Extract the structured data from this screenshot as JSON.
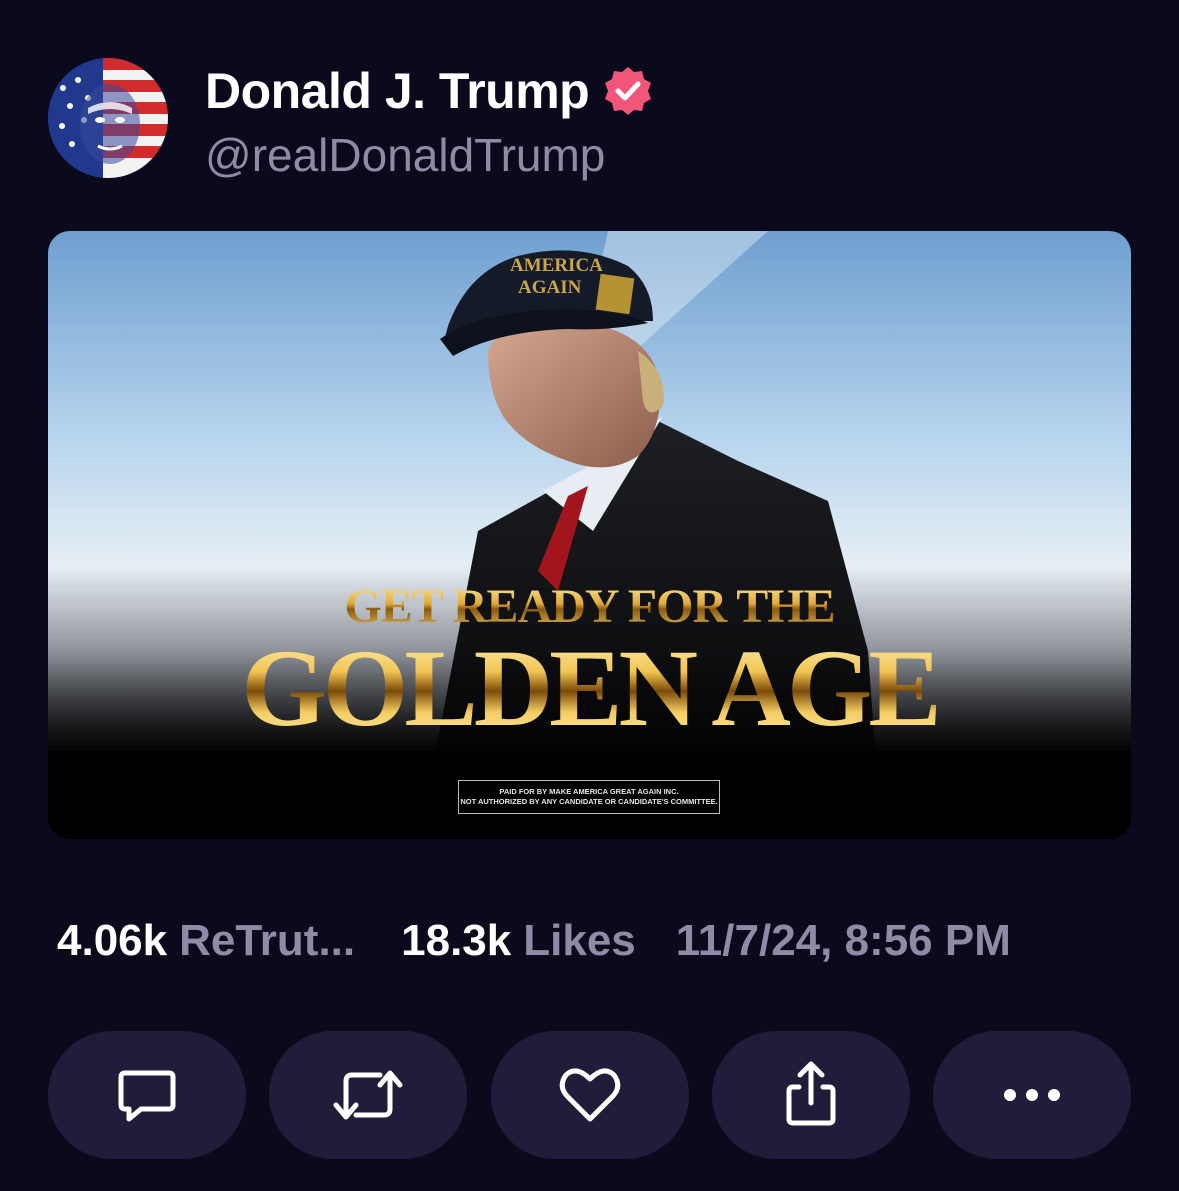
{
  "author": {
    "display_name": "Donald J. Trump",
    "handle": "@realDonaldTrump",
    "verified": true,
    "verified_color": "#f2557a"
  },
  "media": {
    "headline_top": "GET READY FOR THE",
    "headline_main": "GOLDEN AGE",
    "cap_text_line1": "AMERICA",
    "cap_text_line2": "AGAIN",
    "disclaimer_line1": "PAID FOR BY MAKE AMERICA GREAT AGAIN INC.",
    "disclaimer_line2": "NOT AUTHORIZED BY ANY CANDIDATE OR CANDIDATE'S COMMITTEE."
  },
  "stats": {
    "retruths_count": "4.06k",
    "retruths_label": "ReTrut...",
    "likes_count": "18.3k",
    "likes_label": "Likes",
    "timestamp": "11/7/24, 8:56 PM"
  },
  "actions": [
    {
      "icon": "comment-icon"
    },
    {
      "icon": "retruth-icon"
    },
    {
      "icon": "heart-icon"
    },
    {
      "icon": "share-icon"
    },
    {
      "icon": "more-icon"
    }
  ],
  "colors": {
    "background": "#0b0a1c",
    "button_bg": "#1f1d3a",
    "muted_text": "#8e8ba6",
    "gold": "#e7b54a"
  }
}
